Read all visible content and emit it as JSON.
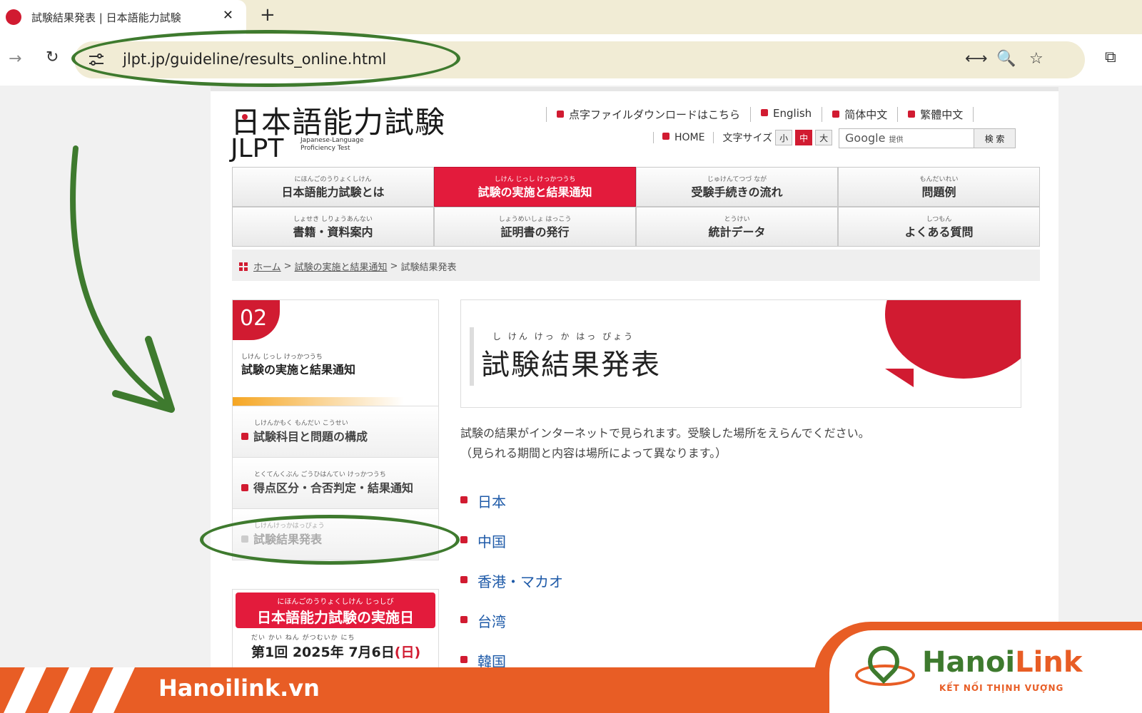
{
  "browser": {
    "tab_title": "試験結果発表 | 日本語能力試験",
    "tab_close": "✕",
    "new_tab": "+",
    "forward_icon": "→",
    "reload_icon": "↻",
    "url": "jlpt.jp/guideline/results_online.html",
    "icons": {
      "translate": "⟷",
      "zoom": "🔍",
      "bookmark": "☆",
      "extensions": "⧉"
    }
  },
  "site": {
    "logo_jp": "日本語能力試験",
    "logo_en": "JLPT",
    "logo_sub": "Japanese-Language Proficiency Test",
    "top_links": [
      "点字ファイルダウンロードはこちら",
      "English",
      "简体中文",
      "繁體中文"
    ],
    "home_link": "HOME",
    "font_size_label": "文字サイズ",
    "font_sizes": [
      "小",
      "中",
      "大"
    ],
    "search_brand": "Google",
    "search_brand_sub": "提供",
    "search_button": "検 索"
  },
  "nav": [
    {
      "ruby": "にほんごのうりょくしけん",
      "label": "日本語能力試験とは"
    },
    {
      "ruby": "しけん じっし けっかつうち",
      "label": "試験の実施と結果通知",
      "active": true
    },
    {
      "ruby": "じゅけんてつづ なが",
      "label": "受験手続きの流れ"
    },
    {
      "ruby": "もんだいれい",
      "label": "問題例"
    },
    {
      "ruby": "しょせき しりょうあんない",
      "label": "書籍・資料案内"
    },
    {
      "ruby": "しょうめいしょ はっこう",
      "label": "証明書の発行"
    },
    {
      "ruby": "とうけい",
      "label": "統計データ"
    },
    {
      "ruby": "しつもん",
      "label": "よくある質問"
    }
  ],
  "breadcrumb": {
    "home": "ホーム",
    "parent": "試験の実施と結果通知",
    "current": "試験結果発表",
    "sep": ">"
  },
  "sidebar": {
    "section_number": "02",
    "section_ruby": "しけん じっし けっかつうち",
    "section_title": "試験の実施と結果通知",
    "items": [
      {
        "ruby": "しけんかもく もんだい こうせい",
        "label": "試験科目と問題の構成"
      },
      {
        "ruby": "とくてんくぶん ごうひはんてい けっかつうち",
        "label": "得点区分・合否判定・結果通知"
      },
      {
        "ruby": "しけんけっかはっぴょう",
        "label": "試験結果発表",
        "current": true
      }
    ],
    "date_box": {
      "ruby": "にほんごのうりょくしけん じっしび",
      "title": "日本語能力試験の実施日",
      "date_ruby": "だい かい ねん がつむいか にち",
      "date_text": "第1回 2025年 7月6日",
      "weekday": "(日)"
    }
  },
  "main": {
    "title_ruby": "し けん けっ か はっ ぴょう",
    "title": "試験結果発表",
    "intro_1": "試験の結果がインターネットで見られます。受験した場所をえらんでください。",
    "intro_2": "（見られる期間と内容は場所によって異なります。）",
    "countries": [
      "日本",
      "中国",
      "香港・マカオ",
      "台湾",
      "韓国"
    ]
  },
  "footer": {
    "url": "Hanoilink.vn",
    "brand_a": "Hanoi",
    "brand_b": "Link",
    "slogan": "KẾT NỐI THỊNH VƯỢNG"
  },
  "colors": {
    "accent": "#d11b31",
    "annotation": "#3e7a2e",
    "banner": "#e85d25"
  }
}
